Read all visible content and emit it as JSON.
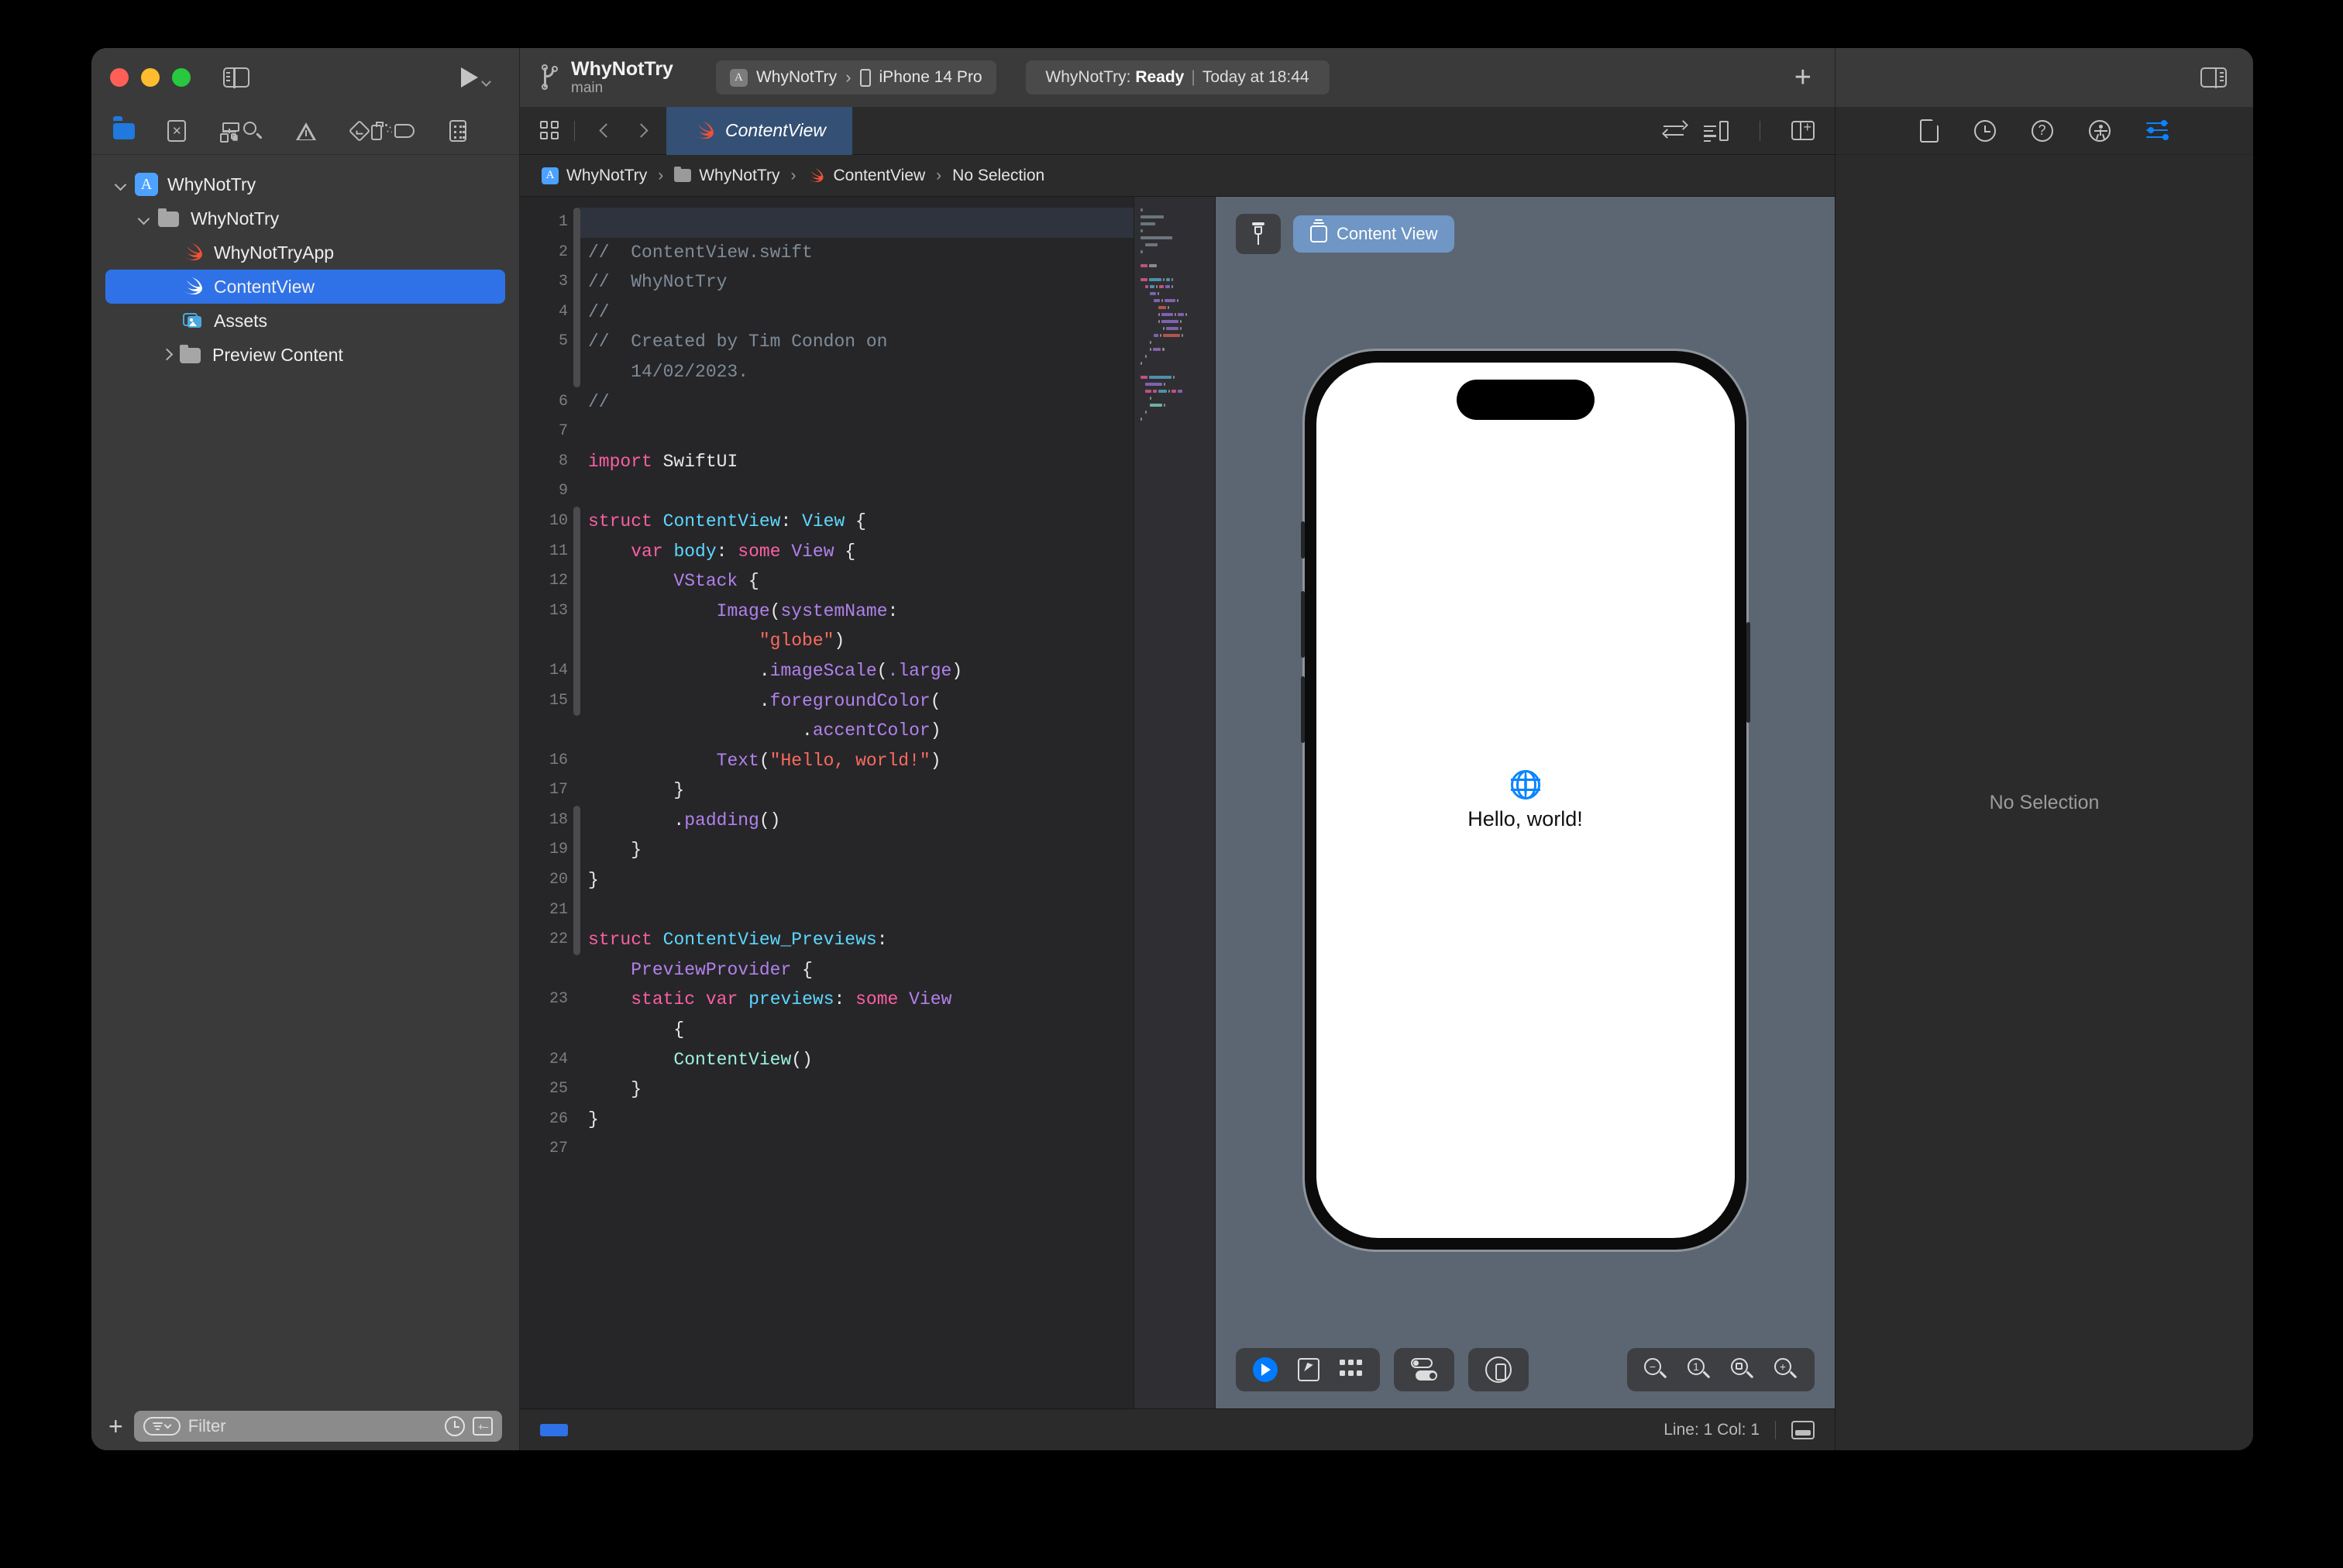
{
  "window": {
    "traffic_lights": [
      "close",
      "minimize",
      "zoom"
    ],
    "sidebar_toggle": "sidebar-toggle",
    "run_button": "run",
    "inspector_toggle": "inspector-toggle"
  },
  "titlebar": {
    "project_name": "WhyNotTry",
    "branch": "main",
    "scheme": "WhyNotTry",
    "destination": "iPhone 14 Pro",
    "status_prefix": "WhyNotTry:",
    "status_state": "Ready",
    "status_separator": "|",
    "status_time": "Today at 18:44",
    "add_label": "+"
  },
  "navigator": {
    "toolbar_icons": [
      "folder-icon",
      "source-control-icon",
      "symbols-icon",
      "search-icon",
      "warning-icon",
      "test-icon",
      "debug-icon",
      "breakpoint-icon",
      "report-icon"
    ],
    "tree": [
      {
        "label": "WhyNotTry",
        "icon": "xcode-project-icon",
        "depth": 0,
        "twisty": "open",
        "selected": false
      },
      {
        "label": "WhyNotTry",
        "icon": "folder-icon",
        "depth": 1,
        "twisty": "open",
        "selected": false
      },
      {
        "label": "WhyNotTryApp",
        "icon": "swift-file-icon",
        "depth": 2,
        "twisty": "none",
        "selected": false
      },
      {
        "label": "ContentView",
        "icon": "swift-file-icon",
        "depth": 2,
        "twisty": "none",
        "selected": true
      },
      {
        "label": "Assets",
        "icon": "assets-icon",
        "depth": 2,
        "twisty": "none",
        "selected": false
      },
      {
        "label": "Preview Content",
        "icon": "folder-icon",
        "depth": 1,
        "twisty": "closed",
        "selected": false
      }
    ],
    "filter_placeholder": "Filter",
    "add_label": "+",
    "recent_icon": "clock-icon",
    "addremove_icon": "add-remove-icon"
  },
  "jumpbar": {
    "related_items_icon": "related-items-icon",
    "back_icon": "chevron-left-icon",
    "forward_icon": "chevron-right-icon",
    "tab_label": "ContentView",
    "right_icons": [
      "adjust-editor-icon",
      "canvas-toggle-icon",
      "add-editor-icon"
    ]
  },
  "breadcrumb": {
    "items": [
      "WhyNotTry",
      "WhyNotTry",
      "ContentView",
      "No Selection"
    ],
    "separator": "›"
  },
  "editor": {
    "selected_line": 1,
    "lines": [
      {
        "num": "1",
        "tokens": [
          {
            "t": "//",
            "c": "cmt"
          }
        ]
      },
      {
        "num": "2",
        "tokens": [
          {
            "t": "//  ContentView.swift",
            "c": "cmt"
          }
        ]
      },
      {
        "num": "3",
        "tokens": [
          {
            "t": "//  WhyNotTry",
            "c": "cmt"
          }
        ]
      },
      {
        "num": "4",
        "tokens": [
          {
            "t": "//",
            "c": "cmt"
          }
        ]
      },
      {
        "num": "5",
        "tokens": [
          {
            "t": "//  Created by Tim Condon on",
            "c": "cmt"
          }
        ]
      },
      {
        "num": "",
        "tokens": [
          {
            "t": "    14/02/2023.",
            "c": "cmt"
          }
        ]
      },
      {
        "num": "6",
        "tokens": [
          {
            "t": "//",
            "c": "cmt"
          }
        ]
      },
      {
        "num": "7",
        "tokens": []
      },
      {
        "num": "8",
        "tokens": [
          {
            "t": "import",
            "c": "kw"
          },
          {
            "t": " SwiftUI",
            "c": "pl"
          }
        ]
      },
      {
        "num": "9",
        "tokens": []
      },
      {
        "num": "10",
        "tokens": [
          {
            "t": "struct",
            "c": "kw"
          },
          {
            "t": " ",
            "c": "pl"
          },
          {
            "t": "ContentView",
            "c": "type"
          },
          {
            "t": ": ",
            "c": "pl"
          },
          {
            "t": "View",
            "c": "type"
          },
          {
            "t": " {",
            "c": "pl"
          }
        ]
      },
      {
        "num": "11",
        "tokens": [
          {
            "t": "    ",
            "c": "pl"
          },
          {
            "t": "var",
            "c": "kw"
          },
          {
            "t": " ",
            "c": "pl"
          },
          {
            "t": "body",
            "c": "type"
          },
          {
            "t": ": ",
            "c": "pl"
          },
          {
            "t": "some",
            "c": "kw"
          },
          {
            "t": " ",
            "c": "pl"
          },
          {
            "t": "View",
            "c": "fn"
          },
          {
            "t": " {",
            "c": "pl"
          }
        ]
      },
      {
        "num": "12",
        "tokens": [
          {
            "t": "        ",
            "c": "pl"
          },
          {
            "t": "VStack",
            "c": "fn"
          },
          {
            "t": " {",
            "c": "pl"
          }
        ]
      },
      {
        "num": "13",
        "tokens": [
          {
            "t": "            ",
            "c": "pl"
          },
          {
            "t": "Image",
            "c": "fn"
          },
          {
            "t": "(",
            "c": "pl"
          },
          {
            "t": "systemName",
            "c": "fn"
          },
          {
            "t": ":",
            "c": "pl"
          }
        ]
      },
      {
        "num": "",
        "tokens": [
          {
            "t": "                ",
            "c": "pl"
          },
          {
            "t": "\"globe\"",
            "c": "str"
          },
          {
            "t": ")",
            "c": "pl"
          }
        ]
      },
      {
        "num": "14",
        "tokens": [
          {
            "t": "                .",
            "c": "pl"
          },
          {
            "t": "imageScale",
            "c": "fn"
          },
          {
            "t": "(",
            "c": "pl"
          },
          {
            "t": ".large",
            "c": "fn"
          },
          {
            "t": ")",
            "c": "pl"
          }
        ]
      },
      {
        "num": "15",
        "tokens": [
          {
            "t": "                .",
            "c": "pl"
          },
          {
            "t": "foregroundColor",
            "c": "fn"
          },
          {
            "t": "(",
            "c": "pl"
          }
        ]
      },
      {
        "num": "",
        "tokens": [
          {
            "t": "                    .",
            "c": "pl"
          },
          {
            "t": "accentColor",
            "c": "fn"
          },
          {
            "t": ")",
            "c": "pl"
          }
        ]
      },
      {
        "num": "16",
        "tokens": [
          {
            "t": "            ",
            "c": "pl"
          },
          {
            "t": "Text",
            "c": "fn"
          },
          {
            "t": "(",
            "c": "pl"
          },
          {
            "t": "\"Hello, world!\"",
            "c": "str"
          },
          {
            "t": ")",
            "c": "pl"
          }
        ]
      },
      {
        "num": "17",
        "tokens": [
          {
            "t": "        }",
            "c": "pl"
          }
        ]
      },
      {
        "num": "18",
        "tokens": [
          {
            "t": "        .",
            "c": "pl"
          },
          {
            "t": "padding",
            "c": "fn"
          },
          {
            "t": "()",
            "c": "pl"
          }
        ]
      },
      {
        "num": "19",
        "tokens": [
          {
            "t": "    }",
            "c": "pl"
          }
        ]
      },
      {
        "num": "20",
        "tokens": [
          {
            "t": "}",
            "c": "pl"
          }
        ]
      },
      {
        "num": "21",
        "tokens": []
      },
      {
        "num": "22",
        "tokens": [
          {
            "t": "struct",
            "c": "kw"
          },
          {
            "t": " ",
            "c": "pl"
          },
          {
            "t": "ContentView_Previews",
            "c": "type"
          },
          {
            "t": ":",
            "c": "pl"
          }
        ]
      },
      {
        "num": "",
        "tokens": [
          {
            "t": "    ",
            "c": "pl"
          },
          {
            "t": "PreviewProvider",
            "c": "fn"
          },
          {
            "t": " {",
            "c": "pl"
          }
        ]
      },
      {
        "num": "23",
        "tokens": [
          {
            "t": "    ",
            "c": "pl"
          },
          {
            "t": "static",
            "c": "kw"
          },
          {
            "t": " ",
            "c": "pl"
          },
          {
            "t": "var",
            "c": "kw"
          },
          {
            "t": " ",
            "c": "pl"
          },
          {
            "t": "previews",
            "c": "type"
          },
          {
            "t": ": ",
            "c": "pl"
          },
          {
            "t": "some",
            "c": "kw"
          },
          {
            "t": " ",
            "c": "pl"
          },
          {
            "t": "View",
            "c": "fn"
          }
        ]
      },
      {
        "num": "",
        "tokens": [
          {
            "t": "        {",
            "c": "pl"
          }
        ]
      },
      {
        "num": "24",
        "tokens": [
          {
            "t": "        ",
            "c": "pl"
          },
          {
            "t": "ContentView",
            "c": "inst"
          },
          {
            "t": "()",
            "c": "pl"
          }
        ]
      },
      {
        "num": "25",
        "tokens": [
          {
            "t": "    }",
            "c": "pl"
          }
        ]
      },
      {
        "num": "26",
        "tokens": [
          {
            "t": "}",
            "c": "pl"
          }
        ]
      },
      {
        "num": "27",
        "tokens": []
      }
    ]
  },
  "canvas": {
    "pin_icon": "pin-icon",
    "view_chip_label": "Content View",
    "preview": {
      "device": "iPhone 14 Pro",
      "icon": "globe-icon",
      "text": "Hello, world!"
    },
    "controls": {
      "live_preview_icon": "live-preview-play-icon",
      "selectable_icon": "selectable-pointer-icon",
      "variants_icon": "variants-grid-icon",
      "device_settings_icon": "device-settings-toggle-icon",
      "orientation_icon": "device-orientation-icon",
      "zoom_out_icon": "zoom-out-icon",
      "zoom_actual_icon": "zoom-actual-size-icon",
      "zoom_fit_icon": "zoom-to-fit-icon",
      "zoom_in_icon": "zoom-in-icon"
    }
  },
  "status_bar": {
    "line_col": "Line: 1  Col: 1",
    "panel_icon": "debug-area-toggle-icon"
  },
  "inspector": {
    "tabs": [
      "file-inspector-icon",
      "history-inspector-icon",
      "quick-help-icon",
      "accessibility-icon",
      "attributes-inspector-icon"
    ],
    "active_tab_index": 4,
    "empty_message": "No Selection"
  },
  "colors": {
    "accent_blue": "#2f72e8",
    "swift_orange": "#f05138",
    "keyword_pink": "#fc5fa3",
    "type_cyan": "#5dd8ff",
    "method_purple": "#b281eb",
    "string_red": "#fc6a5d",
    "comment_gray": "#7f8c98",
    "instance_mint": "#9ef1dd",
    "canvas_bg": "#5c6672"
  }
}
